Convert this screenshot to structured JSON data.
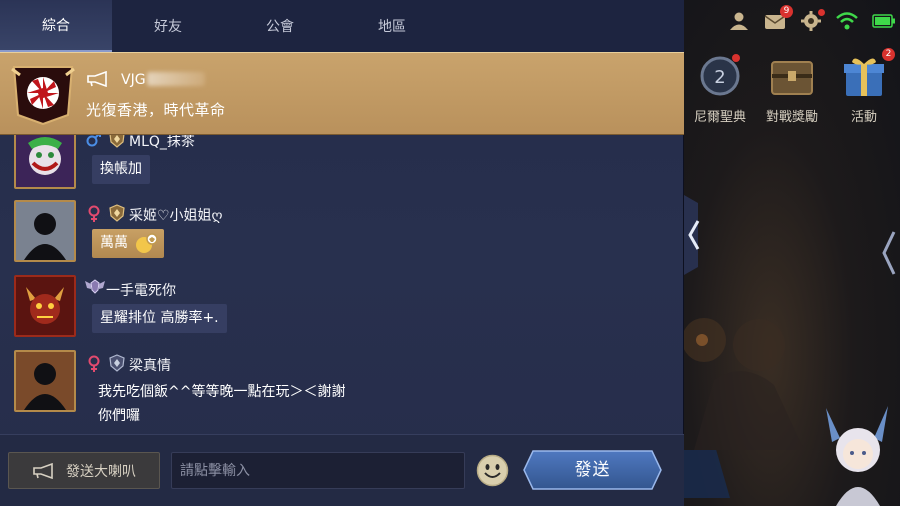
{
  "tabs": [
    {
      "label": "綜合",
      "active": true
    },
    {
      "label": "好友",
      "active": false
    },
    {
      "label": "公會",
      "active": false
    },
    {
      "label": "地區",
      "active": false
    }
  ],
  "pinned_message": {
    "username_visible": "VJG",
    "text": "光復香港，時代革命",
    "icon": "horn-icon"
  },
  "messages": [
    {
      "name": "MLQ_抹茶",
      "gender": "male",
      "text": "換帳加",
      "bubble_style": "normal"
    },
    {
      "name": "采姬♡小姐姐ღ",
      "gender": "female",
      "text": "萬萬",
      "bubble_style": "gold"
    },
    {
      "name": "一手電死你",
      "gender": "",
      "text": "星耀排位 高勝率+.",
      "bubble_style": "normal"
    },
    {
      "name": "梁真情",
      "gender": "female",
      "text_line1": "我先吃個飯^^等等晚一點在玩＞＜謝謝",
      "text_line2": "你們囉",
      "bubble_style": "none"
    }
  ],
  "input_bar": {
    "horn_button_label": "發送大喇叭",
    "input_placeholder": "請點擊輸入",
    "send_label": "發送"
  },
  "game_side": {
    "badges": {
      "mail": "9"
    },
    "menu": [
      {
        "label": "尼爾聖典",
        "icon": "codex-icon"
      },
      {
        "label": "對戰獎勵",
        "icon": "chest-icon"
      },
      {
        "label": "活動",
        "icon": "gift-icon",
        "badge": "2"
      }
    ]
  },
  "colors": {
    "panel": "#262d4a",
    "pinned_gold": "#c9a36c",
    "bubble": "#363e62",
    "send_button": "#4a6fb5"
  }
}
